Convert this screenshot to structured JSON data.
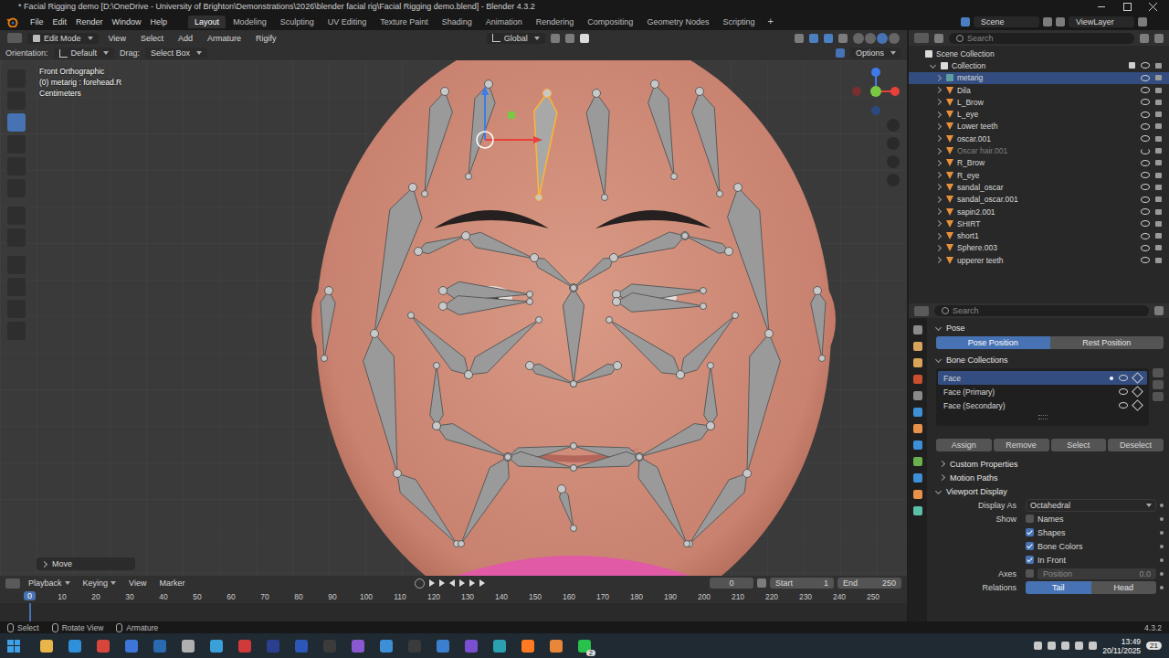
{
  "window": {
    "title": "* Facial Rigging demo [D:\\OneDrive - University of Brighton\\Demonstrations\\2026\\blender facial rig\\Facial Rigging demo.blend] - Blender 4.3.2"
  },
  "menu": [
    "File",
    "Edit",
    "Render",
    "Window",
    "Help"
  ],
  "workspaces": [
    {
      "label": "Layout",
      "selected": true
    },
    {
      "label": "Modeling",
      "selected": false
    },
    {
      "label": "Sculpting",
      "selected": false
    },
    {
      "label": "UV Editing",
      "selected": false
    },
    {
      "label": "Texture Paint",
      "selected": false
    },
    {
      "label": "Shading",
      "selected": false
    },
    {
      "label": "Animation",
      "selected": false
    },
    {
      "label": "Rendering",
      "selected": false
    },
    {
      "label": "Compositing",
      "selected": false
    },
    {
      "label": "Geometry Nodes",
      "selected": false
    },
    {
      "label": "Scripting",
      "selected": false
    }
  ],
  "add_workspace": "+",
  "scene": "Scene",
  "view_layer": "ViewLayer",
  "viewport_header": {
    "mode": "Edit Mode",
    "menus": [
      "View",
      "Select",
      "Add",
      "Armature",
      "Rigify"
    ],
    "transform": "Global"
  },
  "tool_settings": {
    "orientation_label": "Orientation:",
    "orientation": "Default",
    "drag_label": "Drag:",
    "drag": "Select Box",
    "options": "Options"
  },
  "viewport": {
    "view": "Front Orthographic",
    "active": "(0) metarig : forehead.R",
    "units": "Centimeters",
    "last_operator": "Move"
  },
  "outliner": {
    "search_placeholder": "Search",
    "root": "Scene Collection",
    "collection": "Collection",
    "items": [
      {
        "name": "metarig",
        "kind": "armature",
        "selected": true,
        "visible": true
      },
      {
        "name": "Dila",
        "kind": "mesh",
        "selected": false,
        "visible": true
      },
      {
        "name": "L_Brow",
        "kind": "mesh",
        "selected": false,
        "visible": true
      },
      {
        "name": "L_eye",
        "kind": "mesh",
        "selected": false,
        "visible": true
      },
      {
        "name": "Lower teeth",
        "kind": "mesh",
        "selected": false,
        "visible": true
      },
      {
        "name": "oscar.001",
        "kind": "mesh",
        "selected": false,
        "visible": true
      },
      {
        "name": "Oscar hair.001",
        "kind": "mesh",
        "selected": false,
        "visible": false
      },
      {
        "name": "R_Brow",
        "kind": "mesh",
        "selected": false,
        "visible": true
      },
      {
        "name": "R_eye",
        "kind": "mesh",
        "selected": false,
        "visible": true
      },
      {
        "name": "sandal_oscar",
        "kind": "mesh",
        "selected": false,
        "visible": true
      },
      {
        "name": "sandal_oscar.001",
        "kind": "mesh",
        "selected": false,
        "visible": true
      },
      {
        "name": "sapin2.001",
        "kind": "mesh",
        "selected": false,
        "visible": true
      },
      {
        "name": "SHIRT",
        "kind": "mesh",
        "selected": false,
        "visible": true
      },
      {
        "name": "short1",
        "kind": "mesh",
        "selected": false,
        "visible": true
      },
      {
        "name": "Sphere.003",
        "kind": "mesh",
        "selected": false,
        "visible": true
      },
      {
        "name": "upperer teeth",
        "kind": "mesh",
        "selected": false,
        "visible": true
      }
    ]
  },
  "properties": {
    "search_placeholder": "Search",
    "pose": {
      "title": "Pose",
      "options": [
        {
          "label": "Pose Position",
          "selected": true
        },
        {
          "label": "Rest Position",
          "selected": false
        }
      ]
    },
    "bone_collections": {
      "title": "Bone Collections",
      "items": [
        {
          "name": "Face",
          "selected": true
        },
        {
          "name": "Face (Primary)",
          "selected": false
        },
        {
          "name": "Face (Secondary)",
          "selected": false
        }
      ],
      "buttons": [
        "Assign",
        "Remove",
        "Select",
        "Deselect"
      ]
    },
    "sections": [
      "Custom Properties",
      "Motion Paths"
    ],
    "viewport_display": {
      "title": "Viewport Display",
      "display_as_label": "Display As",
      "display_as": "Octahedral",
      "show_label": "Show",
      "show": [
        {
          "label": "Names",
          "checked": false
        },
        {
          "label": "Shapes",
          "checked": true
        },
        {
          "label": "Bone Colors",
          "checked": true
        },
        {
          "label": "In Front",
          "checked": true
        }
      ],
      "axes_label": "Axes",
      "axes_checked": false,
      "position_label": "Position",
      "position": "0.0",
      "relations_label": "Relations",
      "relations": [
        {
          "label": "Tail",
          "selected": true
        },
        {
          "label": "Head",
          "selected": false
        }
      ]
    }
  },
  "timeline": {
    "menus": [
      "Playback",
      "Keying",
      "View",
      "Marker"
    ],
    "current_frame": "0",
    "start_label": "Start",
    "start": "1",
    "end_label": "End",
    "end": "250",
    "playhead": "0",
    "ruler": [
      "10",
      "20",
      "30",
      "40",
      "50",
      "60",
      "70",
      "80",
      "90",
      "100",
      "110",
      "120",
      "130",
      "140",
      "150",
      "160",
      "170",
      "180",
      "190",
      "200",
      "210",
      "220",
      "230",
      "240",
      "250"
    ]
  },
  "status_bar": {
    "items": [
      "Select",
      "Rotate View",
      "Armature"
    ],
    "version": "4.3.2"
  },
  "taskbar": {
    "time": "13:49",
    "date": "20/11/2025",
    "notifications": "21",
    "app_badge": "2"
  }
}
